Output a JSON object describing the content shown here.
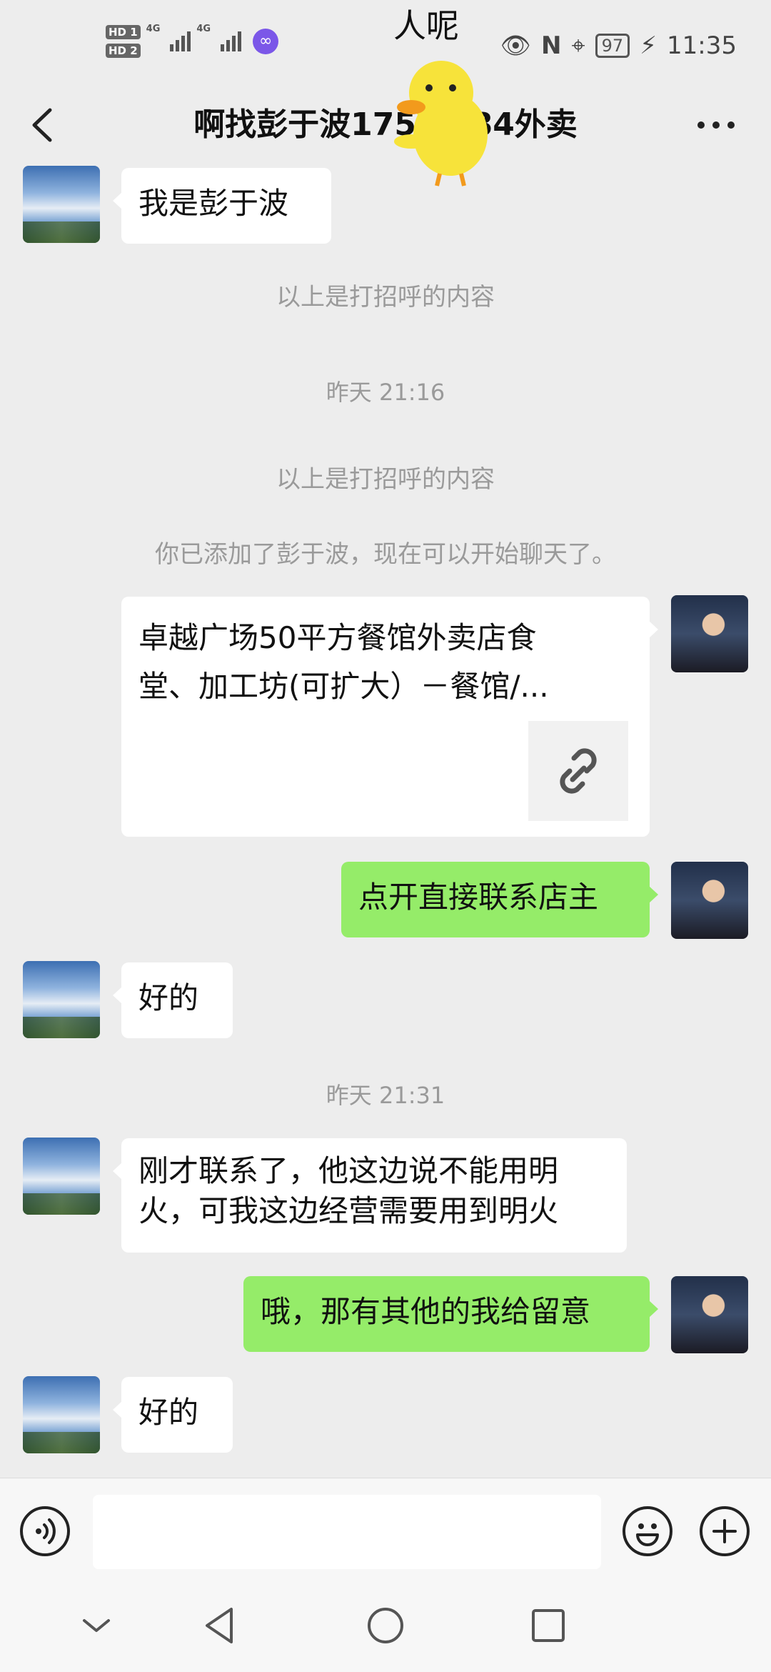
{
  "status_bar": {
    "sim1": "HD 1",
    "sim2": "HD 2",
    "network1": "4G",
    "network2": "4G",
    "battery": "97",
    "time": "11:35"
  },
  "overlay_text": "人呢",
  "header": {
    "title": "啊找彭于波1750    184外卖"
  },
  "messages": [
    {
      "side": "left",
      "text": "我是彭于波"
    },
    {
      "system": "以上是打招呼的内容"
    },
    {
      "timestamp": "昨天 21:16"
    },
    {
      "system2": "以上是打招呼的内容"
    },
    {
      "system3": "你已添加了彭于波，现在可以开始聊天了。"
    },
    {
      "side": "right",
      "card_title": "卓越广场50平方餐馆外卖店食堂、加工坊(可扩大）－餐馆/..."
    },
    {
      "side": "right",
      "text": "点开直接联系店主"
    },
    {
      "side": "left",
      "text": "好的"
    },
    {
      "timestamp": "昨天 21:31"
    },
    {
      "side": "left",
      "text": "刚才联系了，他这边说不能用明火，可我这边经营需要用到明火"
    },
    {
      "side": "right",
      "text": "哦，那有其他的我给留意"
    },
    {
      "side": "left",
      "text": "好的"
    }
  ],
  "input": {
    "value": "",
    "placeholder": ""
  },
  "icons": {
    "back": "chevron-left-icon",
    "more": "more-dots-icon",
    "link": "link-icon",
    "voice": "voice-icon",
    "emoji": "emoji-icon",
    "plus": "plus-icon"
  },
  "colors": {
    "background": "#ededed",
    "sent_bubble": "#95ec69",
    "received_bubble": "#ffffff",
    "system_text": "#9a9a9a"
  }
}
